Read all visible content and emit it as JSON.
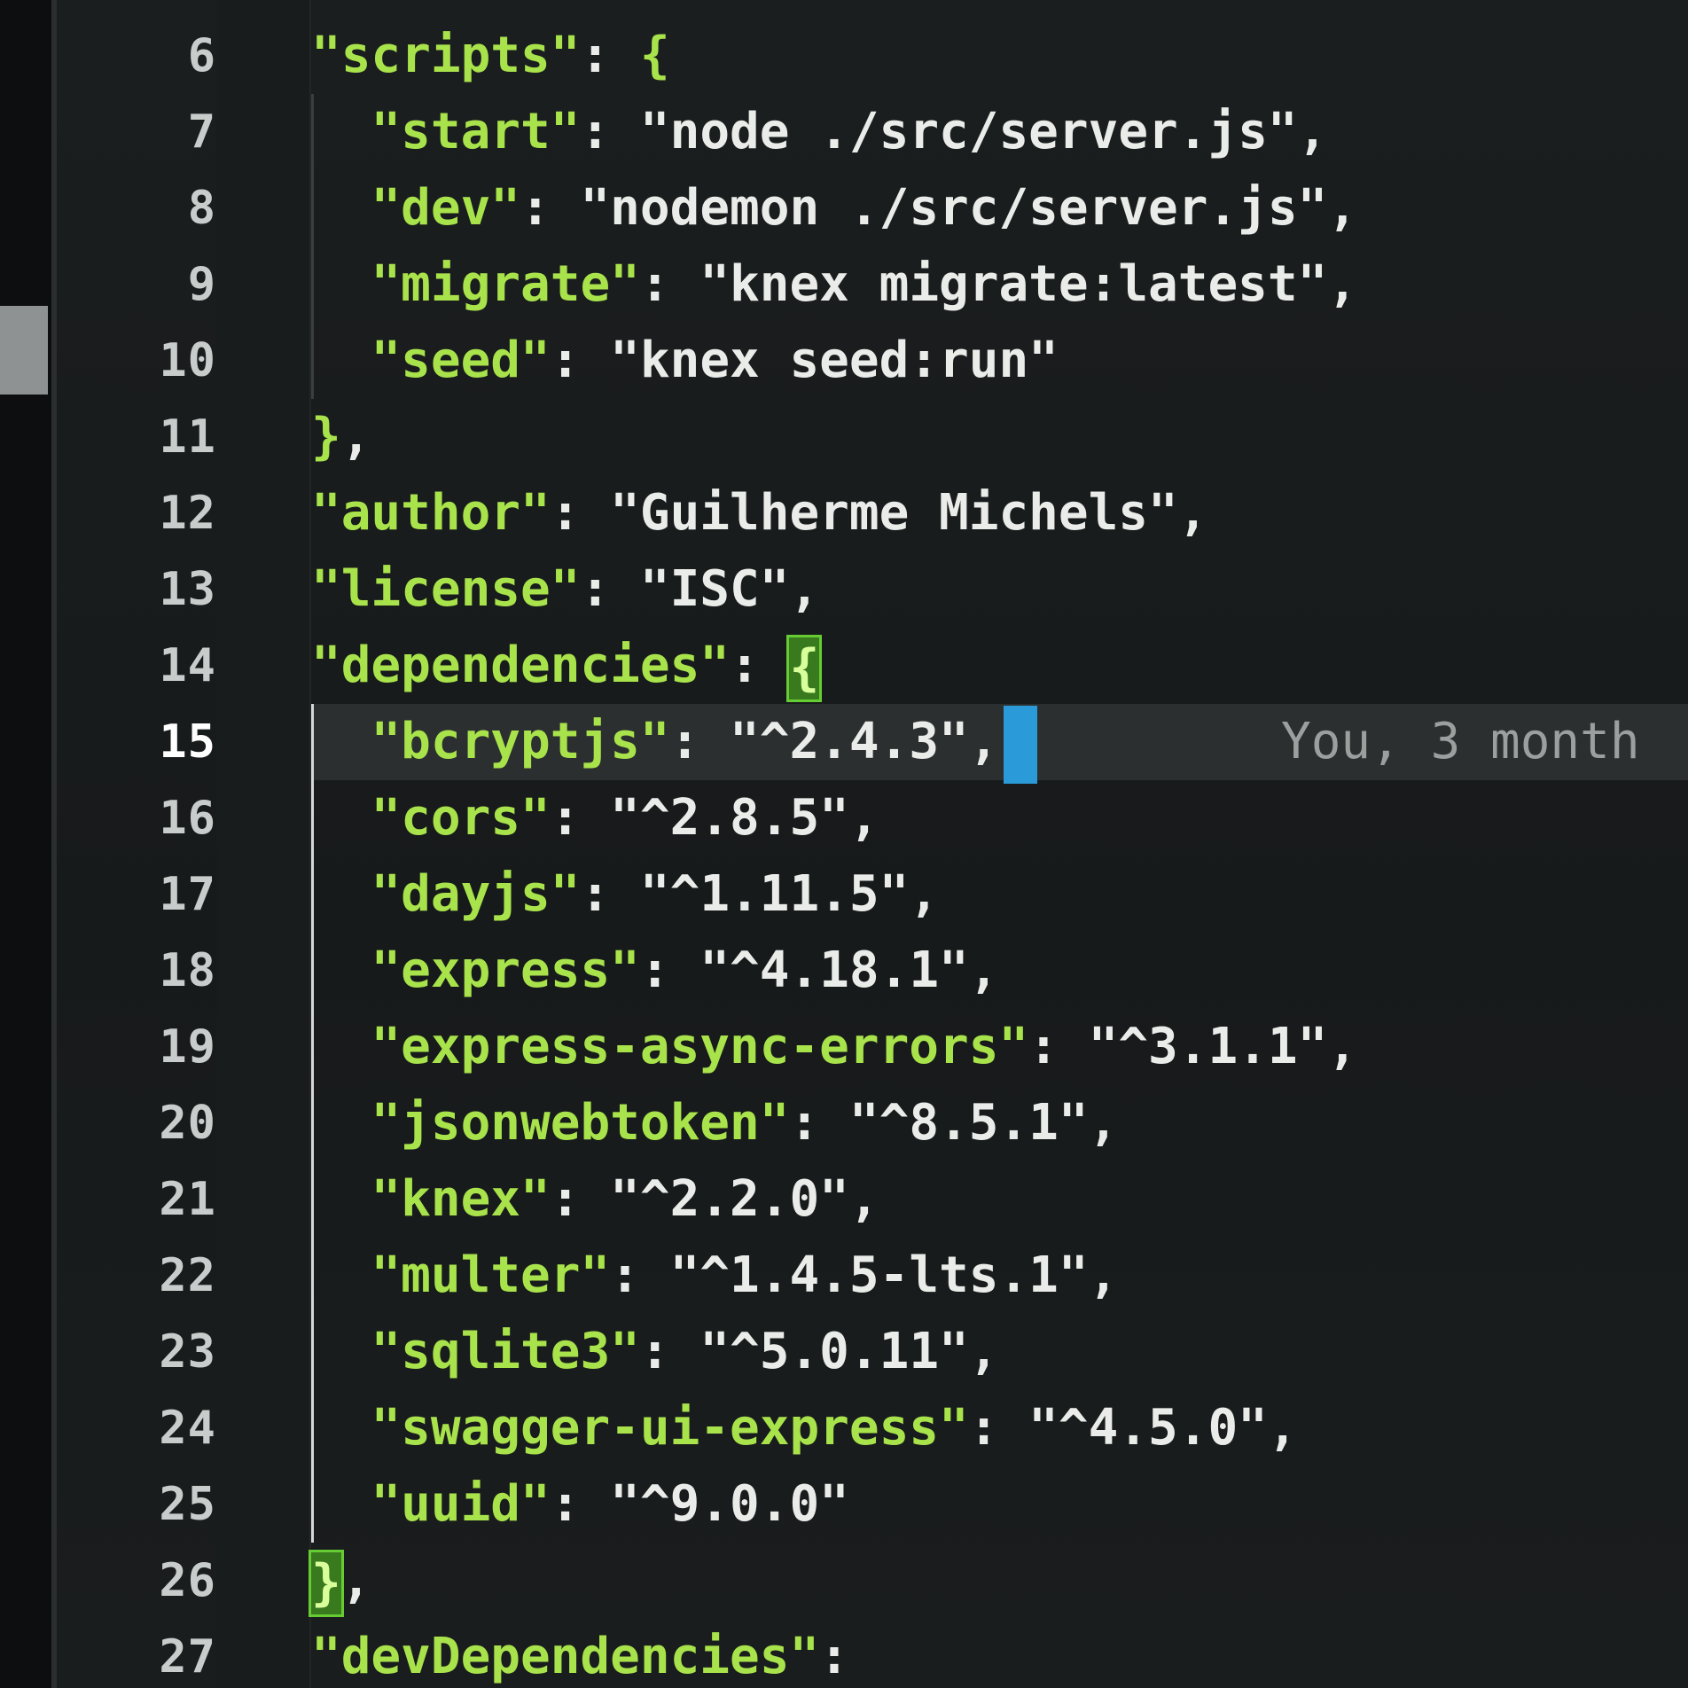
{
  "editor": {
    "active_line": "15",
    "line_numbers": [
      "6",
      "7",
      "8",
      "9",
      "10",
      "11",
      "12",
      "13",
      "14",
      "15",
      "16",
      "17",
      "18",
      "19",
      "20",
      "21",
      "22",
      "23",
      "24",
      "25",
      "26",
      "27"
    ],
    "lines": [
      {
        "key": "\"scripts\"",
        "sep": ": ",
        "open": "{"
      },
      {
        "key": "\"start\"",
        "sep": ": ",
        "value": "\"node ./src/server.js\"",
        "comma": ","
      },
      {
        "key": "\"dev\"",
        "sep": ": ",
        "value": "\"nodemon ./src/server.js\"",
        "comma": ","
      },
      {
        "key": "\"migrate\"",
        "sep": ": ",
        "value": "\"knex migrate:latest\"",
        "comma": ","
      },
      {
        "key": "\"seed\"",
        "sep": ": ",
        "value": "\"knex seed:run\""
      },
      {
        "close": "}",
        "comma": ","
      },
      {
        "key": "\"author\"",
        "sep": ": ",
        "value": "\"Guilherme Michels\"",
        "comma": ","
      },
      {
        "key": "\"license\"",
        "sep": ": ",
        "value": "\"ISC\"",
        "comma": ","
      },
      {
        "key": "\"dependencies\"",
        "sep": ": ",
        "open": "{"
      },
      {
        "key": "\"bcryptjs\"",
        "sep": ": ",
        "value": "\"^2.4.3\"",
        "comma": ","
      },
      {
        "key": "\"cors\"",
        "sep": ": ",
        "value": "\"^2.8.5\"",
        "comma": ","
      },
      {
        "key": "\"dayjs\"",
        "sep": ": ",
        "value": "\"^1.11.5\"",
        "comma": ","
      },
      {
        "key": "\"express\"",
        "sep": ": ",
        "value": "\"^4.18.1\"",
        "comma": ","
      },
      {
        "key": "\"express-async-errors\"",
        "sep": ": ",
        "value": "\"^3.1.1\"",
        "comma": ","
      },
      {
        "key": "\"jsonwebtoken\"",
        "sep": ": ",
        "value": "\"^8.5.1\"",
        "comma": ","
      },
      {
        "key": "\"knex\"",
        "sep": ": ",
        "value": "\"^2.2.0\"",
        "comma": ","
      },
      {
        "key": "\"multer\"",
        "sep": ": ",
        "value": "\"^1.4.5-lts.1\"",
        "comma": ","
      },
      {
        "key": "\"sqlite3\"",
        "sep": ": ",
        "value": "\"^5.0.11\"",
        "comma": ","
      },
      {
        "key": "\"swagger-ui-express\"",
        "sep": ": ",
        "value": "\"^4.5.0\"",
        "comma": ","
      },
      {
        "key": "\"uuid\"",
        "sep": ": ",
        "value": "\"^9.0.0\""
      },
      {
        "close": "}",
        "comma": ","
      },
      {
        "key": "\"devDependencies\"",
        "sep": ": "
      }
    ],
    "blame_annotation": "You, 3 month"
  },
  "colors": {
    "key": "#a9e34b",
    "string": "#e9ece8",
    "cursor": "#2a9bd8",
    "brace_match": "#3a7a1f"
  }
}
